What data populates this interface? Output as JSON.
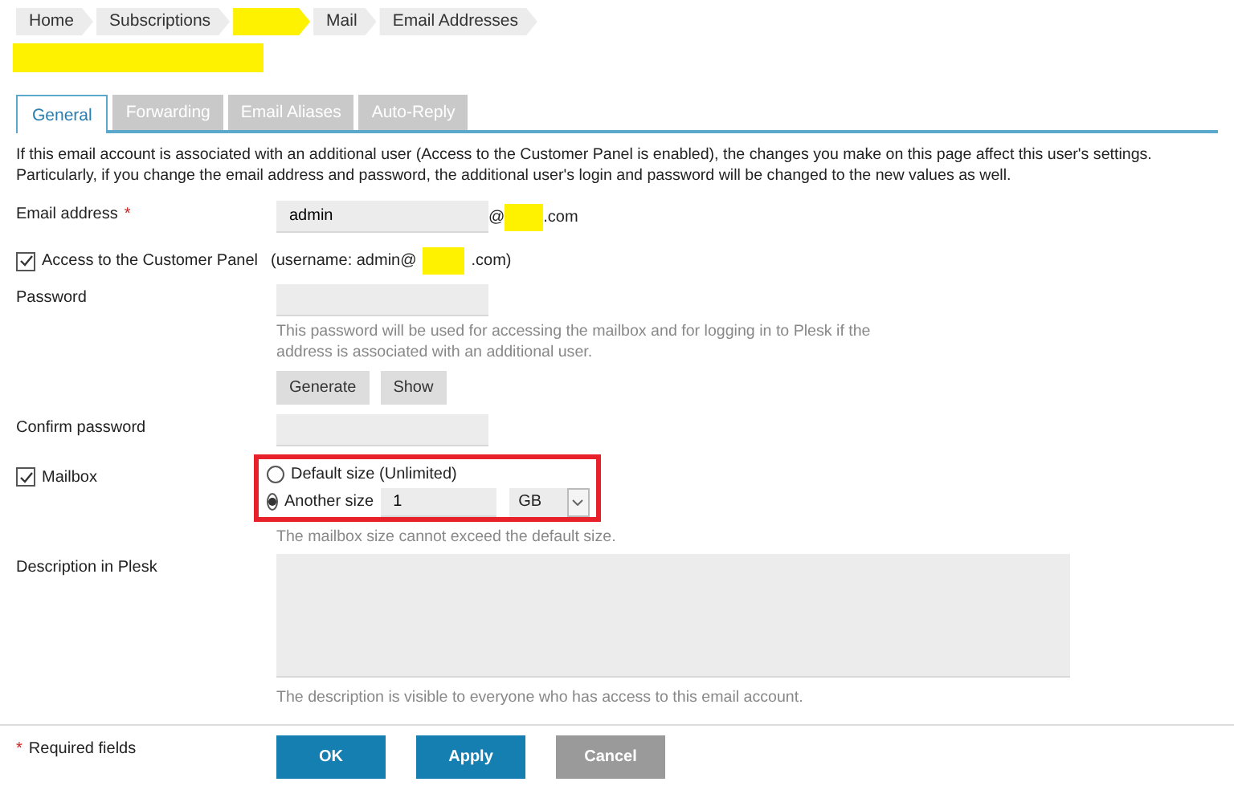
{
  "breadcrumbs": [
    {
      "kind": "text",
      "label": "Home"
    },
    {
      "kind": "text",
      "label": "Subscriptions"
    },
    {
      "kind": "redacted"
    },
    {
      "kind": "text",
      "label": "Mail"
    },
    {
      "kind": "text",
      "label": "Email Addresses"
    }
  ],
  "tabs": [
    {
      "label": "General",
      "selected": true
    },
    {
      "label": "Forwarding",
      "selected": false
    },
    {
      "label": "Email Aliases",
      "selected": false
    },
    {
      "label": "Auto-Reply",
      "selected": false
    }
  ],
  "intro": "If this email account is associated with an additional user (Access to the Customer Panel is enabled), the changes you make on this page affect this user's settings. Particularly, if you change the email address and password, the additional user's login and password will be changed to the new values as well.",
  "email": {
    "label": "Email address",
    "required_mark": "*",
    "value": "admin",
    "at": "@",
    "suffix": ".com"
  },
  "access": {
    "label": "Access to the Customer Panel",
    "checked": true,
    "username_prefix": "(username: admin@",
    "username_suffix": ".com)"
  },
  "password": {
    "label": "Password",
    "hint": "This password will be used for accessing the mailbox and for logging in to Plesk if the address is associated with an additional user.",
    "buttons": [
      "Generate",
      "Show"
    ]
  },
  "confirm": {
    "label": "Confirm password"
  },
  "mailbox": {
    "label": "Mailbox",
    "checked": true,
    "options": [
      {
        "kind": "plain",
        "label": "Default size (Unlimited)",
        "selected": false
      },
      {
        "kind": "size",
        "label": "Another size",
        "selected": true,
        "value": "1",
        "unit": "GB"
      }
    ],
    "hint": "The mailbox size cannot exceed the default size."
  },
  "description": {
    "label": "Description in Plesk",
    "hint": "The description is visible to everyone who has access to this email account."
  },
  "footer": {
    "required_mark": "*",
    "required_label": "Required fields",
    "buttons": [
      {
        "kind": "primary",
        "label": "OK"
      },
      {
        "kind": "primary",
        "label": "Apply"
      },
      {
        "kind": "secondary",
        "label": "Cancel"
      }
    ]
  }
}
